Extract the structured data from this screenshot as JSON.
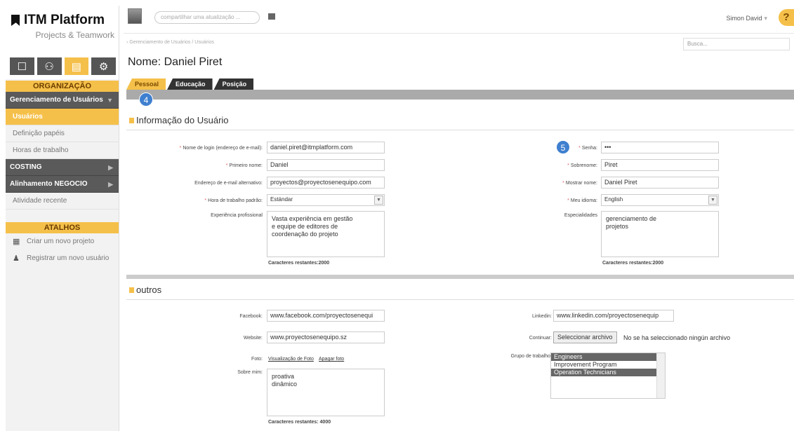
{
  "sidebar": {
    "brand": "ITM Platform",
    "brand_sub": "Projects & Teamwork",
    "section_title": "ORGANIZAÇÃO",
    "groups": {
      "user_mgmt": "Gerenciamento de Usuários",
      "costing": "COSTING",
      "business": "Alinhamento NEGOCIO"
    },
    "items": {
      "users": "Usuários",
      "roles": "Definição papéis",
      "hours": "Horas de trabalho",
      "activity": "Atividade recente"
    },
    "shortcuts_title": "ATALHOS",
    "shortcuts": {
      "new_project": "Criar um novo projeto",
      "new_user": "Registrar um novo usuário"
    }
  },
  "topbar": {
    "share_placeholder": "compartilhar uma atualização ...",
    "user_name": "Simon David",
    "help": "?"
  },
  "main": {
    "breadcrumb": "› Gerenciamento de Usuários / Usuários",
    "search_placeholder": "Busca...",
    "page_title": "Nome: Daniel Piret",
    "tabs": {
      "personal": "Pessoal",
      "education": "Educação",
      "position": "Posição"
    },
    "badges": {
      "b4": "4",
      "b5": "5"
    },
    "section_user": "Informação do Usuário",
    "section_other": "outros"
  },
  "form": {
    "login_label": "Nome de login (endereço de e-mail):",
    "login_value": "daniel.piret@itmplatform.com",
    "first_name_label": "Primeiro nome:",
    "first_name_value": "Daniel",
    "alt_email_label": "Endereço de e-mail alternativo:",
    "alt_email_value": "proyectos@proyectosenequipo.com",
    "workhours_label": "Hora de trabalho padrão:",
    "workhours_value": "Estándar",
    "experience_label": "Experiência profissional",
    "experience_lines": [
      "Vasta experiência em gestão",
      "e equipe de editores de",
      "coordenação do projeto"
    ],
    "experience_remaining": "Caracteres restantes:2000",
    "password_label": "Senha:",
    "password_value": "•••",
    "last_name_label": "Sobrenome:",
    "last_name_value": "Piret",
    "display_name_label": "Mostrar nome:",
    "display_name_value": "Daniel Piret",
    "language_label": "Meu idioma:",
    "language_value": "English",
    "specialties_label": "Especialidades",
    "specialties_lines": [
      "gerenciamento de",
      "projetos"
    ],
    "specialties_remaining": "Caracteres restantes:2000",
    "facebook_label": "Facebook:",
    "facebook_value": "www.facebook.com/proyectosenequi",
    "website_label": "Website:",
    "website_value": "www.proyectosenequipo.sz",
    "photo_label": "Foto:",
    "photo_view": "Visualização de Foto",
    "photo_delete": "Apagar foto",
    "about_label": "Sobre mim:",
    "about_lines": [
      "proativa",
      "dinâmico"
    ],
    "about_remaining": "Caracteres restantes: 4000",
    "linkedin_label": "Linkedin:",
    "linkedin_value": "www.linkedin.com/proyectosenequip",
    "continue_label": "Continuar:",
    "file_button": "Seleccionar archivo",
    "file_status": "No se ha seleccionado ningún archivo",
    "workgroup_label": "Grupo de trabalho:",
    "workgroups": [
      "Engineers",
      "Improvement Program",
      "Operation Technicians"
    ]
  },
  "colors": {
    "accent": "#f5c04a",
    "dark": "#5a5a5a",
    "badge": "#3f7fcf"
  }
}
